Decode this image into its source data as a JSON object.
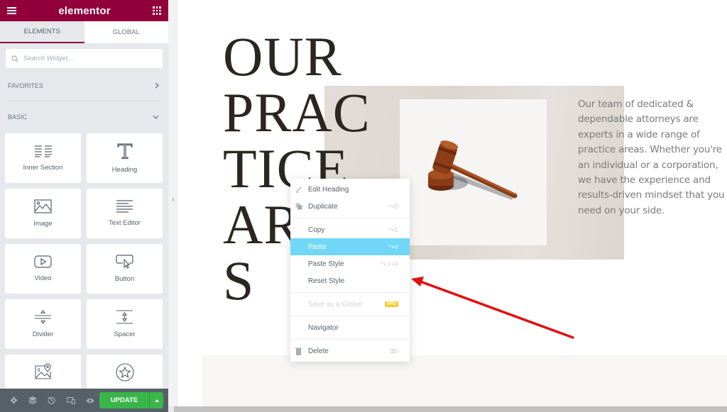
{
  "app": {
    "logo": "elementor",
    "brand_color": "#92003b"
  },
  "sidebar": {
    "tabs": [
      {
        "label": "ELEMENTS",
        "active": true
      },
      {
        "label": "GLOBAL",
        "active": false
      }
    ],
    "search": {
      "placeholder": "Search Widget..."
    },
    "categories": [
      {
        "label": "FAVORITES",
        "state": "collapsed"
      },
      {
        "label": "BASIC",
        "state": "expanded"
      }
    ],
    "widgets": [
      {
        "label": "Inner Section",
        "icon": "inner-section-icon"
      },
      {
        "label": "Heading",
        "icon": "heading-icon"
      },
      {
        "label": "Image",
        "icon": "image-icon"
      },
      {
        "label": "Text Editor",
        "icon": "text-editor-icon"
      },
      {
        "label": "Video",
        "icon": "video-icon"
      },
      {
        "label": "Button",
        "icon": "button-icon"
      },
      {
        "label": "Divider",
        "icon": "divider-icon"
      },
      {
        "label": "Spacer",
        "icon": "spacer-icon"
      },
      {
        "label": "",
        "icon": "google-maps-icon"
      },
      {
        "label": "",
        "icon": "icon-widget-icon"
      }
    ],
    "footer": {
      "icons": [
        "settings-icon",
        "navigator-layers-icon",
        "history-icon",
        "responsive-mode-icon",
        "preview-icon"
      ],
      "update_label": "UPDATE",
      "update_color": "#39b54a"
    }
  },
  "canvas": {
    "heading": "OUR PRACTICE AREAS",
    "heading_lines": [
      "OUR",
      "PRAC",
      "TICE",
      "AREA",
      "S"
    ],
    "paragraph": "Our team of dedicated & dependable attorneys are experts in a wide range of practice areas. Whether you're an individual or a corporation, we have the experience and results-driven mindset that you need on your side."
  },
  "context_menu": {
    "items": [
      {
        "label": "Edit Heading",
        "shortcut": "",
        "icon": "pencil-icon",
        "state": "normal"
      },
      {
        "label": "Duplicate",
        "shortcut": "^+D",
        "icon": "duplicate-icon",
        "state": "normal"
      },
      {
        "label": "Copy",
        "shortcut": "^+C",
        "icon": "",
        "state": "normal"
      },
      {
        "label": "Paste",
        "shortcut": "^+V",
        "icon": "",
        "state": "highlighted"
      },
      {
        "label": "Paste Style",
        "shortcut": "^+⇧+V",
        "icon": "",
        "state": "normal"
      },
      {
        "label": "Reset Style",
        "shortcut": "",
        "icon": "",
        "state": "normal"
      },
      {
        "label": "Save as a Global",
        "shortcut": "",
        "badge": "PRO",
        "icon": "",
        "state": "disabled"
      },
      {
        "label": "Navigator",
        "shortcut": "",
        "icon": "",
        "state": "normal"
      },
      {
        "label": "Delete",
        "shortcut": "⌦",
        "icon": "trash-icon",
        "state": "normal"
      }
    ],
    "highlight_color": "#71d7f7"
  },
  "annotation": {
    "arrow_color": "#e01010",
    "points_to": "Reset Style"
  }
}
